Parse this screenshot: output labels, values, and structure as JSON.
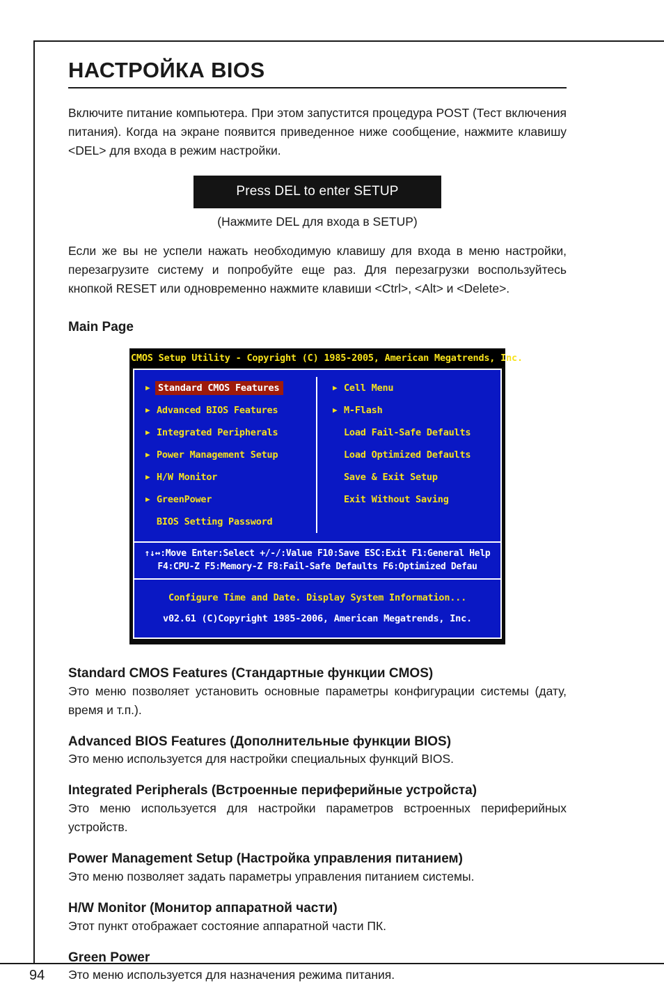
{
  "page": {
    "number": "94"
  },
  "chapter": {
    "title": "НАСТРОЙКА BIOS",
    "intro": "Включите питание компьютера. При этом запустится процедура POST (Тест включения питания). Когда на экране появится приведенное ниже сообщение, нажмите клавишу <DEL> для входа в режим настройки.",
    "post_box_message": "Press DEL to enter SETUP",
    "post_box_caption": "(Нажмите DEL для входа в SETUP)",
    "retry_paragraph": "Если же вы не успели нажать необходимую клавишу для входа в меню настройки, перезагрузите систему и попробуйте еще раз. Для перезагрузки воспользуйтесь кнопкой RESET или одновременно нажмите клавиши <Ctrl>, <Alt> и <Delete>.",
    "main_page_heading": "Main Page"
  },
  "bios": {
    "titlebar": "CMOS Setup Utility - Copyright (C) 1985-2005, American Megatrends, Inc.",
    "left_items": [
      {
        "label": "Standard CMOS Features",
        "arrow": true,
        "selected": true
      },
      {
        "label": "Advanced BIOS Features",
        "arrow": true,
        "selected": false
      },
      {
        "label": "Integrated Peripherals",
        "arrow": true,
        "selected": false
      },
      {
        "label": "Power Management Setup",
        "arrow": true,
        "selected": false
      },
      {
        "label": "H/W Monitor",
        "arrow": true,
        "selected": false
      },
      {
        "label": "GreenPower",
        "arrow": true,
        "selected": false
      },
      {
        "label": "BIOS Setting Password",
        "arrow": false,
        "selected": false
      }
    ],
    "right_items": [
      {
        "label": "Cell Menu",
        "arrow": true,
        "selected": false
      },
      {
        "label": "M-Flash",
        "arrow": true,
        "selected": false
      },
      {
        "label": "Load Fail-Safe Defaults",
        "arrow": false,
        "selected": false
      },
      {
        "label": "Load Optimized Defaults",
        "arrow": false,
        "selected": false
      },
      {
        "label": "Save & Exit Setup",
        "arrow": false,
        "selected": false
      },
      {
        "label": "Exit Without Saving",
        "arrow": false,
        "selected": false
      }
    ],
    "keys_line1": "↑↓↔:Move  Enter:Select  +/-/:Value  F10:Save  ESC:Exit  F1:General Help",
    "keys_line2": "F4:CPU-Z     F5:Memory-Z       F8:Fail-Safe Defaults      F6:Optimized Defau",
    "status_help": "Configure Time and Date.  Display System Information...",
    "status_version": "v02.61 (C)Copyright 1985-2006, American Megatrends, Inc.",
    "colors": {
      "background": "#0a18c4",
      "titlebar_background": "#000000",
      "titlebar_text": "#f7e21c",
      "item_text": "#f7e21c",
      "selected_background": "#9e1b0b",
      "selected_text": "#ffffff",
      "frame": "#ffffff",
      "key_text": "#ffffff"
    }
  },
  "descriptions": [
    {
      "heading": "Standard CMOS Features (Стандартные функции CMOS)",
      "text": "Это меню позволяет установить основные параметры конфигурации системы (дату, время и т.п.)."
    },
    {
      "heading": "Advanced BIOS Features (Дополнительные функции BIOS)",
      "text": "Это меню используется для настройки специальных функций BIOS."
    },
    {
      "heading": "Integrated Peripherals (Встроенные периферийные устройста)",
      "text": "Это меню используется для настройки параметров встроенных периферийных устройств."
    },
    {
      "heading": "Power Management Setup (Настройка управления питанием)",
      "text": "Это меню позволяет задать параметры управления питанием системы."
    },
    {
      "heading": "H/W Monitor (Монитор аппаратной части)",
      "text": "Этот пункт отображает состояние аппаратной части ПК."
    },
    {
      "heading": "Green Power",
      "text": "Это меню используется для назначения режима питания."
    }
  ]
}
